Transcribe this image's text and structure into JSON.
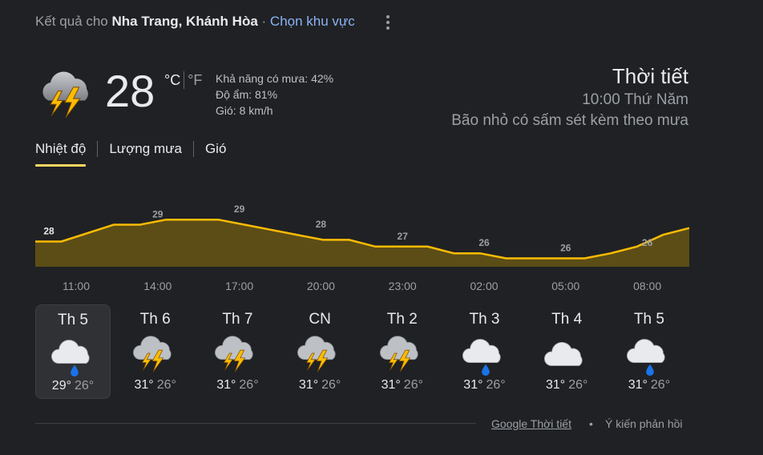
{
  "header": {
    "prefix": "Kết quả cho",
    "location": "Nha Trang, Khánh Hòa",
    "separator": "·",
    "change_region": "Chọn khu vực",
    "more_icon": "more-vert-icon"
  },
  "current": {
    "icon": "thunderstorm-icon",
    "temp": "28",
    "unit_c": "°C",
    "unit_f": "°F",
    "rain_chance": "Khả năng có mưa: 42%",
    "humidity": "Độ ẩm: 81%",
    "wind": "Gió: 8 km/h",
    "title": "Thời tiết",
    "time": "10:00 Thứ Năm",
    "condition": "Bão nhỏ có sấm sét kèm theo mưa"
  },
  "tabs": [
    {
      "label": "Nhiệt độ",
      "active": true
    },
    {
      "label": "Lượng mưa",
      "active": false
    },
    {
      "label": "Gió",
      "active": false
    }
  ],
  "chart_data": {
    "type": "area",
    "title": "",
    "xlabel": "",
    "ylabel": "",
    "x": [
      "10:00",
      "11:00",
      "12:00",
      "13:00",
      "14:00",
      "15:00",
      "16:00",
      "17:00",
      "18:00",
      "19:00",
      "20:00",
      "21:00",
      "22:00",
      "23:00",
      "00:00",
      "01:00",
      "02:00",
      "03:00",
      "04:00",
      "05:00",
      "06:00",
      "07:00",
      "08:00",
      "09:00",
      "10:00"
    ],
    "series": [
      {
        "values": [
          28,
          28,
          28.5,
          29,
          29,
          29.3,
          29.3,
          29.3,
          29,
          28.7,
          28.4,
          28.1,
          28.1,
          27.7,
          27.7,
          27.7,
          27.3,
          27.3,
          27,
          27,
          27,
          27,
          27.3,
          27.7,
          28.4,
          28.8
        ]
      }
    ],
    "labels": [
      {
        "hour": "11:00",
        "value": "28"
      },
      {
        "hour": "14:00",
        "value": "29"
      },
      {
        "hour": "17:00",
        "value": "29"
      },
      {
        "hour": "20:00",
        "value": "28"
      },
      {
        "hour": "23:00",
        "value": "27"
      },
      {
        "hour": "02:00",
        "value": "26"
      },
      {
        "hour": "05:00",
        "value": "26"
      },
      {
        "hour": "08:00",
        "value": "26"
      }
    ],
    "hour_ticks": [
      "11:00",
      "14:00",
      "17:00",
      "20:00",
      "23:00",
      "02:00",
      "05:00",
      "08:00"
    ],
    "line_color": "#fbbc04",
    "fill_color": "#5c4d16"
  },
  "days": [
    {
      "name": "Th 5",
      "icon": "cloud-rain-icon",
      "hi": "29°",
      "lo": "26°",
      "selected": true
    },
    {
      "name": "Th 6",
      "icon": "thunderstorm-icon",
      "hi": "31°",
      "lo": "26°",
      "selected": false
    },
    {
      "name": "Th 7",
      "icon": "thunderstorm-icon",
      "hi": "31°",
      "lo": "26°",
      "selected": false
    },
    {
      "name": "CN",
      "icon": "thunderstorm-icon",
      "hi": "31°",
      "lo": "26°",
      "selected": false
    },
    {
      "name": "Th 2",
      "icon": "thunderstorm-icon",
      "hi": "31°",
      "lo": "26°",
      "selected": false
    },
    {
      "name": "Th 3",
      "icon": "cloud-rain-icon",
      "hi": "31°",
      "lo": "26°",
      "selected": false
    },
    {
      "name": "Th 4",
      "icon": "cloud-icon",
      "hi": "31°",
      "lo": "26°",
      "selected": false
    },
    {
      "name": "Th 5",
      "icon": "cloud-rain-icon",
      "hi": "31°",
      "lo": "26°",
      "selected": false
    }
  ],
  "footer": {
    "source_link": "Google Thời tiết",
    "dot": "•",
    "feedback": "Ý kiến phản hồi"
  }
}
